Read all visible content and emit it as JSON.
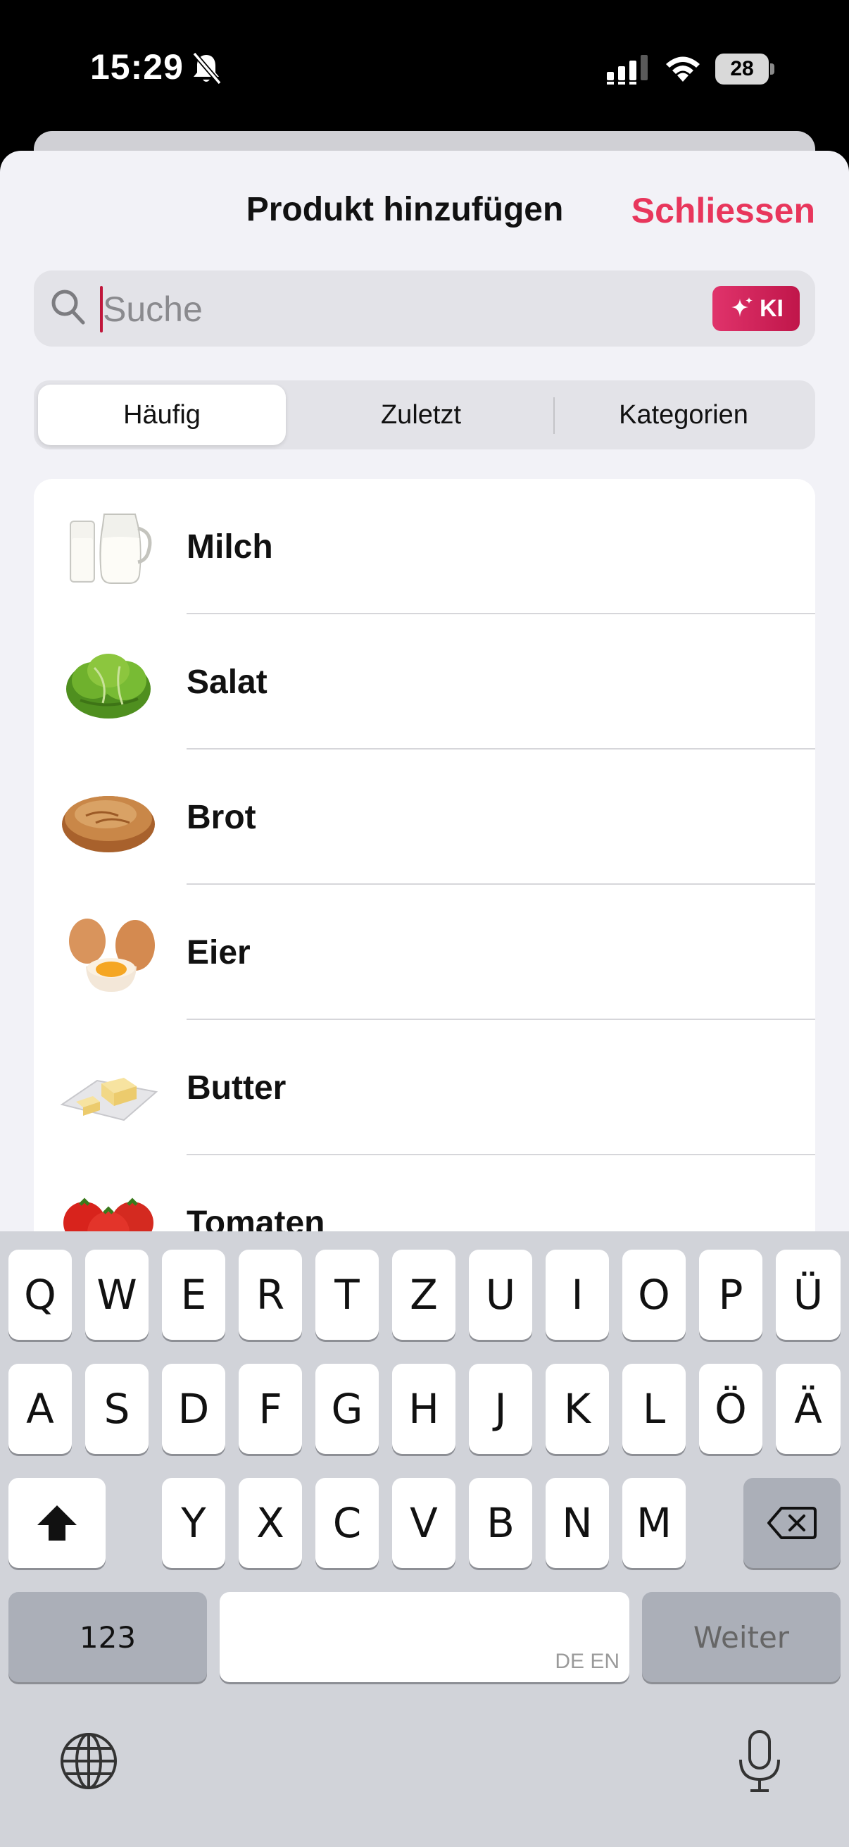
{
  "status_bar": {
    "time": "15:29",
    "battery": "28",
    "icons": [
      "bell-slash-icon",
      "signal-icon",
      "wifi-icon",
      "battery-icon"
    ]
  },
  "sheet": {
    "title": "Produkt hinzufügen",
    "close_label": "Schliessen",
    "accent_color": "#e8365c"
  },
  "search": {
    "placeholder": "Suche",
    "value": "",
    "ai_button_label": "KI"
  },
  "tabs": [
    {
      "label": "Häufig",
      "active": true
    },
    {
      "label": "Zuletzt",
      "active": false
    },
    {
      "label": "Kategorien",
      "active": false
    }
  ],
  "products": [
    {
      "label": "Milch",
      "icon": "milk-icon"
    },
    {
      "label": "Salat",
      "icon": "lettuce-icon"
    },
    {
      "label": "Brot",
      "icon": "bread-icon"
    },
    {
      "label": "Eier",
      "icon": "eggs-icon"
    },
    {
      "label": "Butter",
      "icon": "butter-icon"
    },
    {
      "label": "Tomaten",
      "icon": "tomatoes-icon"
    }
  ],
  "keyboard": {
    "row1": [
      "Q",
      "W",
      "E",
      "R",
      "T",
      "Z",
      "U",
      "I",
      "O",
      "P",
      "Ü"
    ],
    "row2": [
      "A",
      "S",
      "D",
      "F",
      "G",
      "H",
      "J",
      "K",
      "L",
      "Ö",
      "Ä"
    ],
    "row3": [
      "Y",
      "X",
      "C",
      "V",
      "B",
      "N",
      "M"
    ],
    "numbers_label": "123",
    "space_hint": "DE EN",
    "return_label": "Weiter"
  }
}
